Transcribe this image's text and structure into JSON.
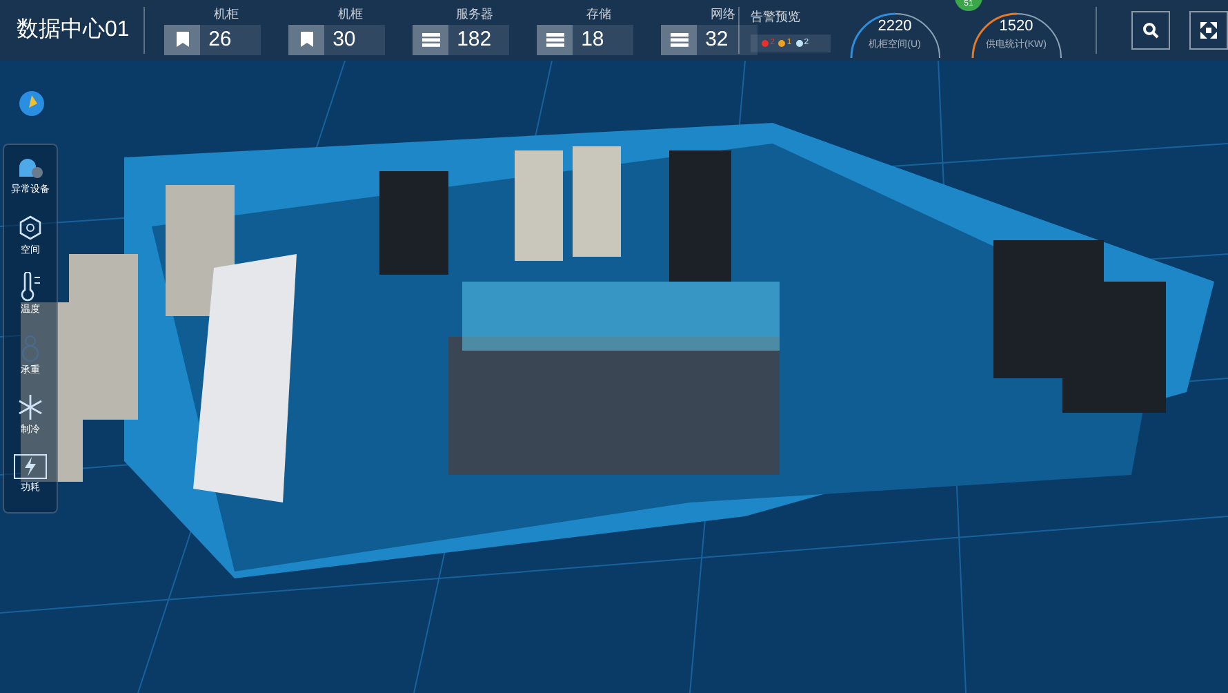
{
  "header": {
    "title": "数据中心01",
    "stats": [
      {
        "label": "机柜",
        "value": "26",
        "kind": "bookmark"
      },
      {
        "label": "机框",
        "value": "30",
        "kind": "bookmark"
      },
      {
        "label": "服务器",
        "value": "182",
        "kind": "server"
      },
      {
        "label": "存储",
        "value": "18",
        "kind": "server"
      },
      {
        "label": "网络",
        "value": "32",
        "kind": "server"
      }
    ],
    "alerts": {
      "label": "告警预览",
      "items": [
        {
          "count": "2",
          "color": "#e8312a"
        },
        {
          "count": "1",
          "color": "#f0a020"
        },
        {
          "count": "2",
          "color": "#bfe4f5"
        }
      ]
    },
    "badge": "51",
    "gauges": [
      {
        "value": "2220",
        "label": "机柜空间(U)",
        "color": "#2a8fe0"
      },
      {
        "value": "1520",
        "label": "供电统计(KW)",
        "color": "#e87a24"
      }
    ]
  },
  "sidebar": {
    "items": [
      {
        "label": "异常设备",
        "kind": "alarm",
        "selected": false
      },
      {
        "label": "空间",
        "kind": "space",
        "selected": false
      },
      {
        "label": "温度",
        "kind": "temp",
        "selected": false
      },
      {
        "label": "承重",
        "kind": "weight",
        "selected": false
      },
      {
        "label": "制冷",
        "kind": "snow",
        "selected": false
      },
      {
        "label": "功耗",
        "kind": "power",
        "selected": true
      }
    ]
  }
}
